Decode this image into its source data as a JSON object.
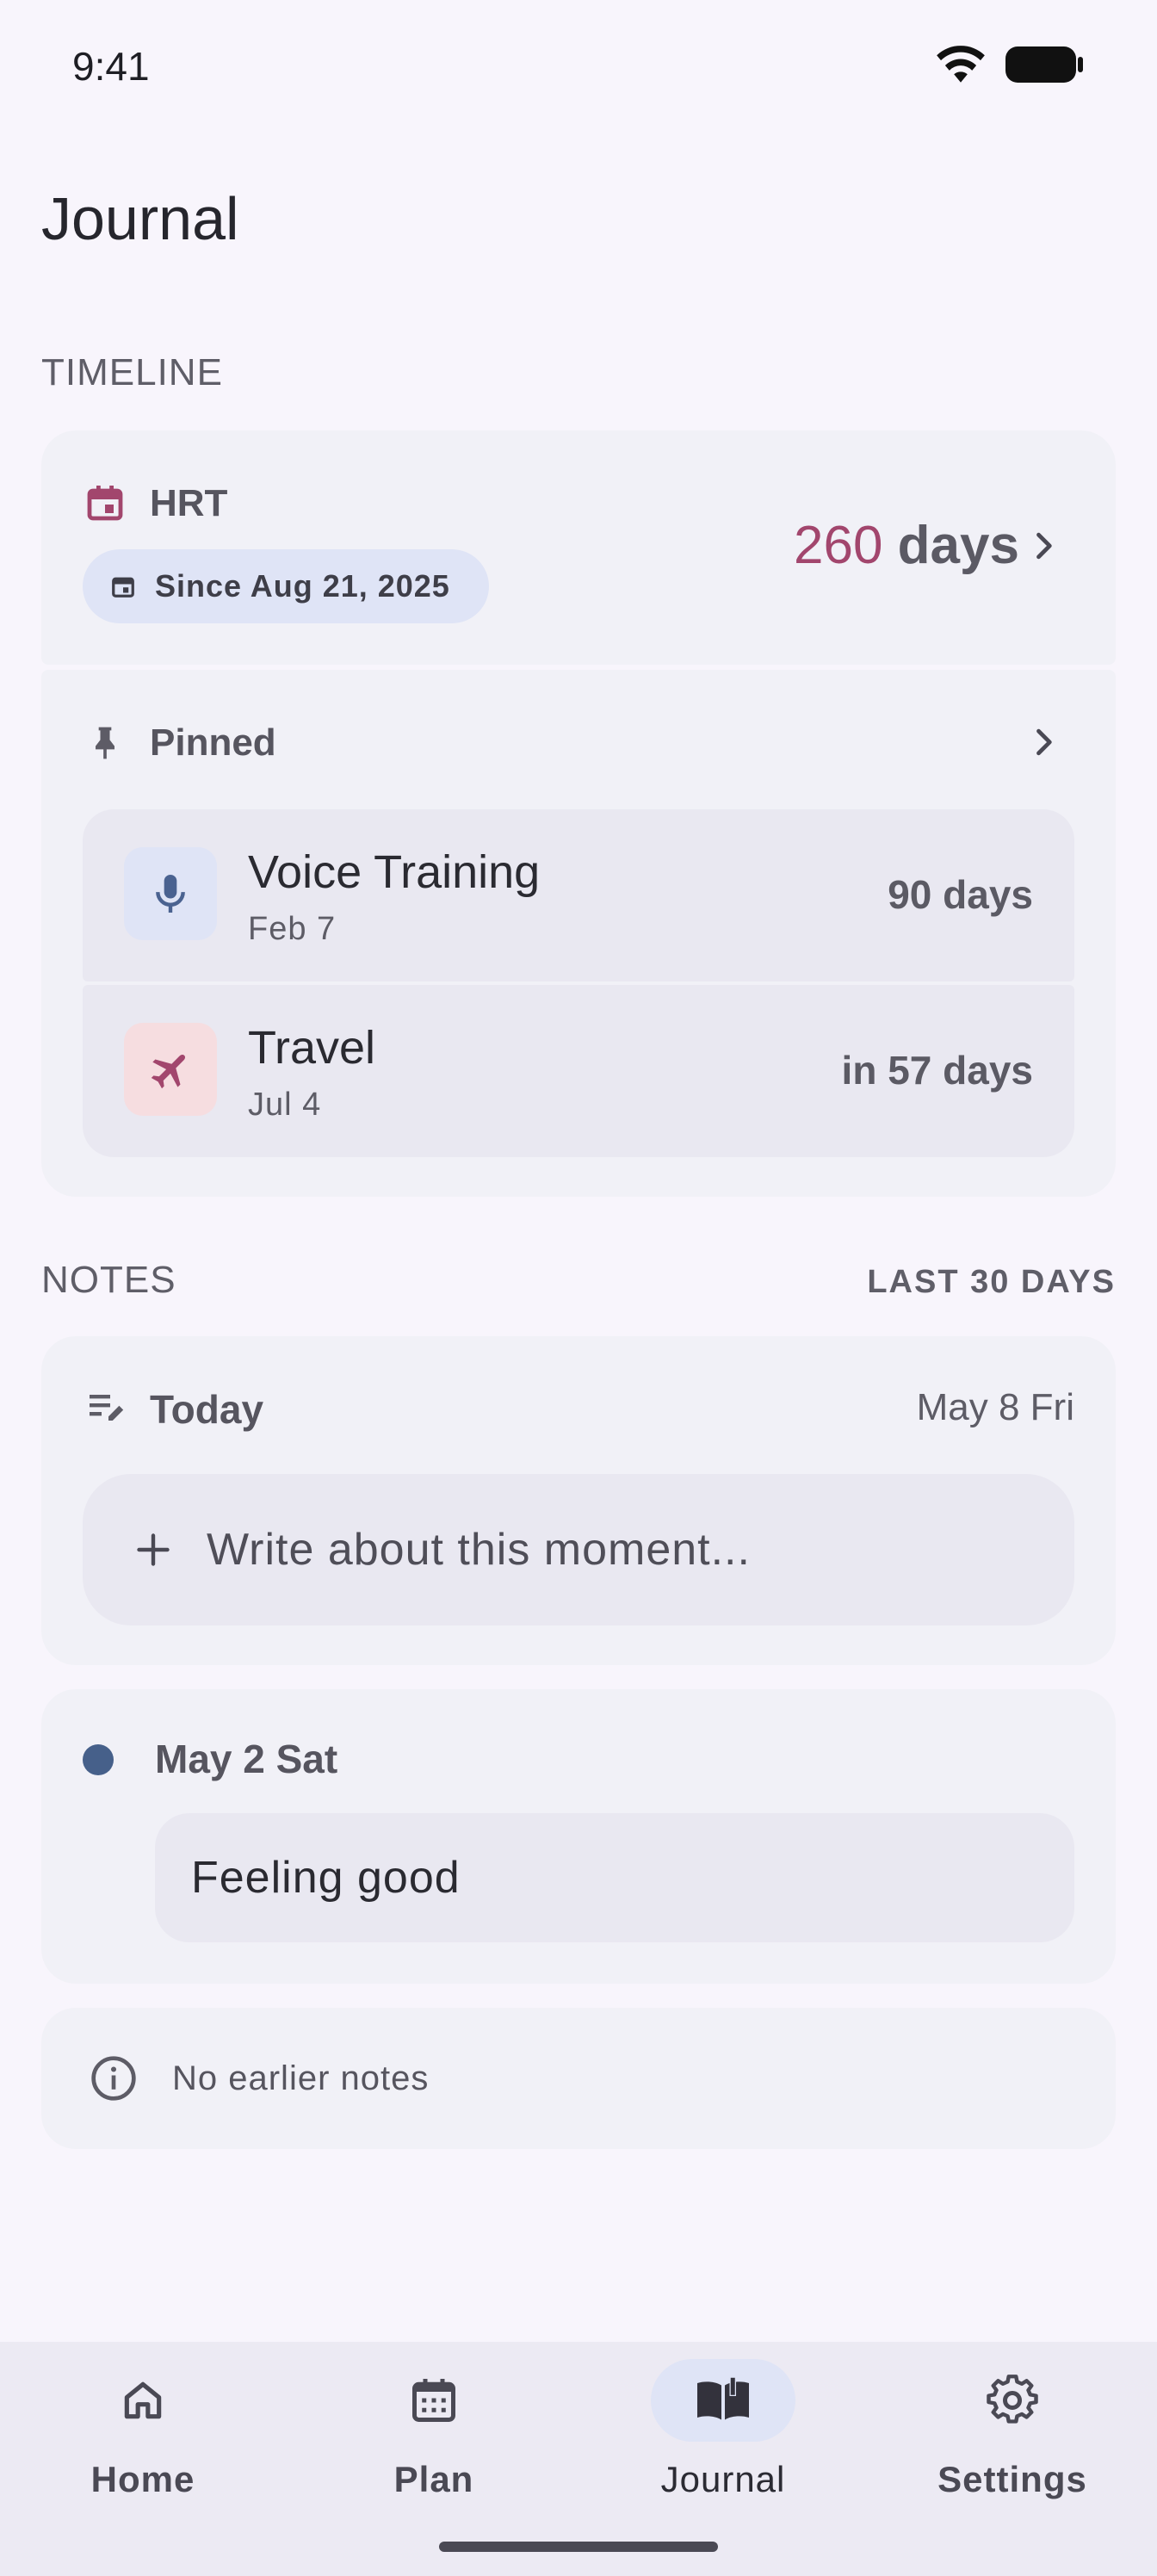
{
  "status": {
    "time": "9:41"
  },
  "page": {
    "title": "Journal"
  },
  "timeline": {
    "section_label": "TIMELINE",
    "hrt": {
      "title": "HRT",
      "since": "Since Aug 21, 2025",
      "count": "260",
      "unit": "days"
    },
    "pinned": {
      "title": "Pinned",
      "items": [
        {
          "name": "Voice Training",
          "date": "Feb 7",
          "relative": "90 days",
          "icon": "mic-icon",
          "icon_bg": "#dfe4f6",
          "icon_color": "#4a6290"
        },
        {
          "name": "Travel",
          "date": "Jul 4",
          "relative": "in 57 days",
          "icon": "airplane-icon",
          "icon_bg": "#f6dde0",
          "icon_color": "#a2466d"
        }
      ]
    }
  },
  "notes": {
    "section_label": "NOTES",
    "range_label": "LAST 30 DAYS",
    "today": {
      "title": "Today",
      "date": "May 8 Fri",
      "placeholder": "Write about this moment..."
    },
    "entries": [
      {
        "date": "May 2 Sat",
        "text": "Feeling good"
      }
    ],
    "empty_message": "No earlier notes"
  },
  "nav": {
    "items": [
      {
        "label": "Home",
        "icon": "home-icon"
      },
      {
        "label": "Plan",
        "icon": "calendar-grid-icon"
      },
      {
        "label": "Journal",
        "icon": "book-icon",
        "active": true
      },
      {
        "label": "Settings",
        "icon": "gear-icon"
      }
    ]
  },
  "colors": {
    "accent": "#a2466d",
    "chip_bg": "#dfe4f6",
    "entry_dot": "#46608a"
  }
}
